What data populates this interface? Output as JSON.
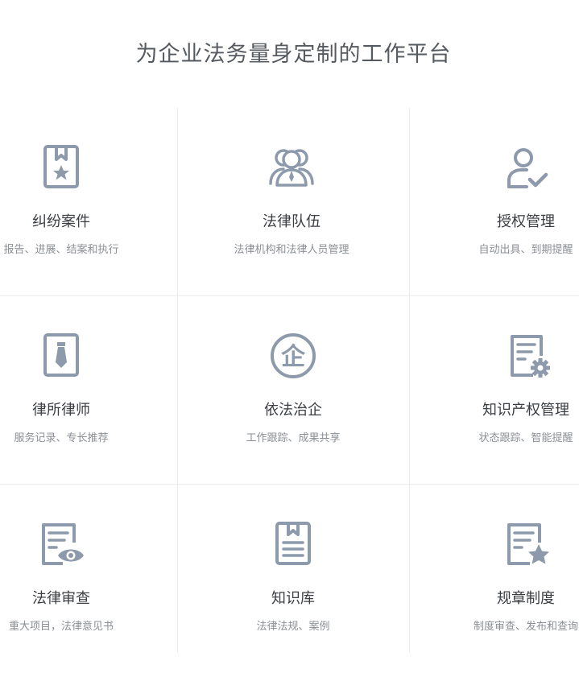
{
  "page": {
    "title": "为企业法务量身定制的工作平台"
  },
  "colors": {
    "icon": "#8d9aab",
    "divider": "#ececec",
    "title_text": "#3a3d42",
    "desc_text": "#8b8f95"
  },
  "features": [
    {
      "title": "纠纷案件",
      "desc": "报告、进展、结案和执行",
      "icon": "bookmark-star-icon"
    },
    {
      "title": "法律队伍",
      "desc": "法律机构和法律人员管理",
      "icon": "team-icon"
    },
    {
      "title": "授权管理",
      "desc": "自动出具、到期提醒",
      "icon": "user-check-icon"
    },
    {
      "title": "律所律师",
      "desc": "服务记录、专长推荐",
      "icon": "lawyer-tie-icon"
    },
    {
      "title": "依法治企",
      "desc": "工作跟踪、成果共享",
      "icon": "enterprise-seal-icon",
      "icon_glyph": "企"
    },
    {
      "title": "知识产权管理",
      "desc": "状态跟踪、智能提醒",
      "icon": "document-gear-icon"
    },
    {
      "title": "法律审查",
      "desc": "重大项目，法律意见书",
      "icon": "document-eye-icon"
    },
    {
      "title": "知识库",
      "desc": "法律法规、案例",
      "icon": "knowledge-book-icon"
    },
    {
      "title": "规章制度",
      "desc": "制度审查、发布和查询",
      "icon": "document-star-icon"
    }
  ]
}
